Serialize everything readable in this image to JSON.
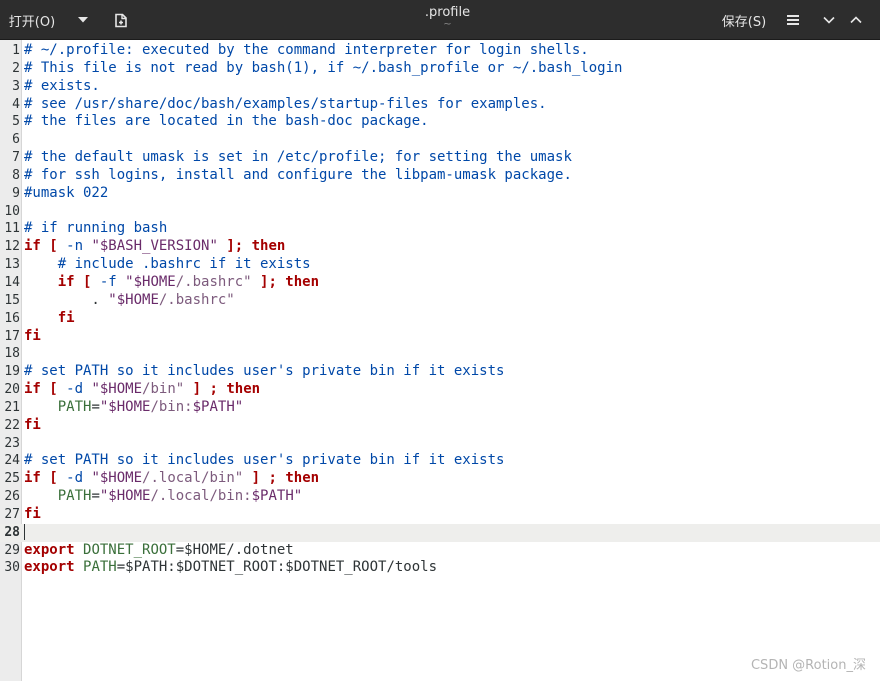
{
  "window": {
    "open_label": "打开(O)",
    "open_menu_icon": "chevron-down-icon",
    "new_document_icon": "new-document-icon",
    "title": ".profile",
    "subtitle": "~",
    "save_label": "保存(S)",
    "menu_icon": "hamburger-icon",
    "minimize_icon": "chevron-down-icon",
    "maximize_icon": "chevron-up-icon"
  },
  "editor": {
    "current_line": 28,
    "lines": [
      {
        "num": "1",
        "tokens": [
          {
            "t": "# ~/.profile: executed by the command interpreter for login shells.",
            "k": "comment"
          }
        ]
      },
      {
        "num": "2",
        "tokens": [
          {
            "t": "# This file is not read by bash(1), if ~/.bash_profile or ~/.bash_login",
            "k": "comment"
          }
        ]
      },
      {
        "num": "3",
        "tokens": [
          {
            "t": "# exists.",
            "k": "comment"
          }
        ]
      },
      {
        "num": "4",
        "tokens": [
          {
            "t": "# see /usr/share/doc/bash/examples/startup-files for examples.",
            "k": "comment"
          }
        ]
      },
      {
        "num": "5",
        "tokens": [
          {
            "t": "# the files are located in the bash-doc package.",
            "k": "comment"
          }
        ]
      },
      {
        "num": "6",
        "tokens": []
      },
      {
        "num": "7",
        "tokens": [
          {
            "t": "# the default umask is set in /etc/profile; for setting the umask",
            "k": "comment"
          }
        ]
      },
      {
        "num": "8",
        "tokens": [
          {
            "t": "# for ssh logins, install and configure the libpam-umask package.",
            "k": "comment"
          }
        ]
      },
      {
        "num": "9",
        "tokens": [
          {
            "t": "#umask 022",
            "k": "comment"
          }
        ]
      },
      {
        "num": "10",
        "tokens": []
      },
      {
        "num": "11",
        "tokens": [
          {
            "t": "# if running bash",
            "k": "comment"
          }
        ]
      },
      {
        "num": "12",
        "tokens": [
          {
            "t": "if [ ",
            "k": "keyword"
          },
          {
            "t": "-n ",
            "k": "comment"
          },
          {
            "t": "\"$BASH_VERSION\"",
            "k": "string"
          },
          {
            "t": " ]; then",
            "k": "keyword"
          }
        ]
      },
      {
        "num": "13",
        "tokens": [
          {
            "t": "    # include .bashrc if it exists",
            "k": "comment"
          }
        ]
      },
      {
        "num": "14",
        "tokens": [
          {
            "t": "    if [ ",
            "k": "keyword"
          },
          {
            "t": "-f ",
            "k": "comment"
          },
          {
            "t": "\"$HOME",
            "k": "string"
          },
          {
            "t": "/.bashrc\"",
            "k": "path"
          },
          {
            "t": " ]; then",
            "k": "keyword"
          }
        ]
      },
      {
        "num": "15",
        "tokens": [
          {
            "t": "        . ",
            "k": "plain"
          },
          {
            "t": "\"$HOME",
            "k": "string"
          },
          {
            "t": "/.bashrc\"",
            "k": "path"
          }
        ]
      },
      {
        "num": "16",
        "tokens": [
          {
            "t": "    fi",
            "k": "keyword"
          }
        ]
      },
      {
        "num": "17",
        "tokens": [
          {
            "t": "fi",
            "k": "keyword"
          }
        ]
      },
      {
        "num": "18",
        "tokens": []
      },
      {
        "num": "19",
        "tokens": [
          {
            "t": "# set PATH so it includes user's private bin if it exists",
            "k": "comment"
          }
        ]
      },
      {
        "num": "20",
        "tokens": [
          {
            "t": "if [ ",
            "k": "keyword"
          },
          {
            "t": "-d ",
            "k": "comment"
          },
          {
            "t": "\"$HOME",
            "k": "string"
          },
          {
            "t": "/bin\"",
            "k": "path"
          },
          {
            "t": " ] ; then",
            "k": "keyword"
          }
        ]
      },
      {
        "num": "21",
        "tokens": [
          {
            "t": "    PATH",
            "k": "var"
          },
          {
            "t": "=",
            "k": "plain"
          },
          {
            "t": "\"$HOME",
            "k": "string"
          },
          {
            "t": "/bin:",
            "k": "path"
          },
          {
            "t": "$PATH\"",
            "k": "string"
          }
        ]
      },
      {
        "num": "22",
        "tokens": [
          {
            "t": "fi",
            "k": "keyword"
          }
        ]
      },
      {
        "num": "23",
        "tokens": []
      },
      {
        "num": "24",
        "tokens": [
          {
            "t": "# set PATH so it includes user's private bin if it exists",
            "k": "comment"
          }
        ]
      },
      {
        "num": "25",
        "tokens": [
          {
            "t": "if [ ",
            "k": "keyword"
          },
          {
            "t": "-d ",
            "k": "comment"
          },
          {
            "t": "\"$HOME",
            "k": "string"
          },
          {
            "t": "/.local/bin\"",
            "k": "path"
          },
          {
            "t": " ] ; then",
            "k": "keyword"
          }
        ]
      },
      {
        "num": "26",
        "tokens": [
          {
            "t": "    PATH",
            "k": "var"
          },
          {
            "t": "=",
            "k": "plain"
          },
          {
            "t": "\"$HOME",
            "k": "string"
          },
          {
            "t": "/.local/bin:",
            "k": "path"
          },
          {
            "t": "$PATH\"",
            "k": "string"
          }
        ]
      },
      {
        "num": "27",
        "tokens": [
          {
            "t": "fi",
            "k": "keyword"
          }
        ]
      },
      {
        "num": "28",
        "tokens": []
      },
      {
        "num": "29",
        "tokens": [
          {
            "t": "export ",
            "k": "builtin"
          },
          {
            "t": "DOTNET_ROOT",
            "k": "var"
          },
          {
            "t": "=$HOME/.dotnet",
            "k": "plain"
          }
        ]
      },
      {
        "num": "30",
        "tokens": [
          {
            "t": "export ",
            "k": "builtin"
          },
          {
            "t": "PATH",
            "k": "var"
          },
          {
            "t": "=$PATH:$DOTNET_ROOT:$DOTNET_ROOT/tools",
            "k": "plain"
          }
        ]
      }
    ]
  },
  "watermark": "CSDN @Rotion_深",
  "colors": {
    "headerbar": "#2d2d2d",
    "comment": "#0048a8",
    "keyword": "#a40000",
    "string": "#6a2b6a",
    "variable": "#3a6f3a",
    "current_line": "#eeeeec"
  }
}
